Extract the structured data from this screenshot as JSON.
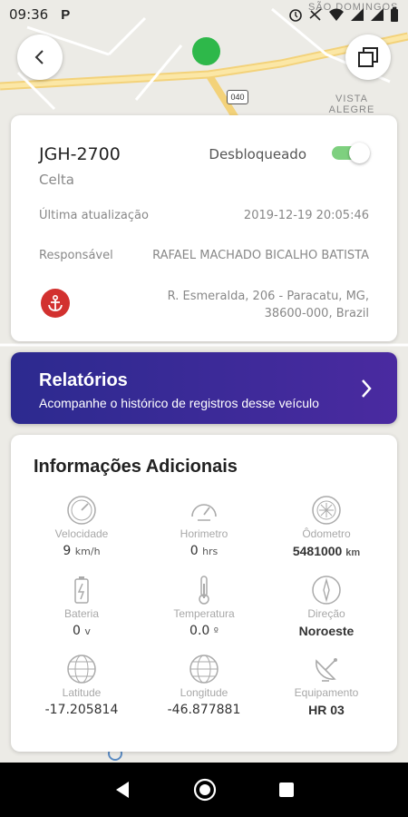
{
  "status_bar": {
    "time": "09:36",
    "app_icon": "P"
  },
  "map": {
    "labels": [
      "SÃO DOMINGOS",
      "VISTA ALEGRE",
      "040"
    ],
    "marker_color": "#2eb84a"
  },
  "vehicle": {
    "plate": "JGH-2700",
    "model": "Celta",
    "lock_status": "Desbloqueado",
    "toggle_on": true,
    "last_update_label": "Última atualização",
    "last_update_value": "2019-12-19 20:05:46",
    "responsible_label": "Responsável",
    "responsible_value": "RAFAEL MACHADO BICALHO BATISTA",
    "address_line1": "R. Esmeralda, 206 - Paracatu, MG,",
    "address_line2": "38600-000, Brazil"
  },
  "reports": {
    "title": "Relatórios",
    "subtitle": "Acompanhe o histórico de registros desse veículo"
  },
  "info": {
    "title": "Informações Adicionais",
    "items": [
      {
        "icon": "speedometer-icon",
        "label": "Velocidade",
        "value": "9",
        "unit": "km/h",
        "bold": false
      },
      {
        "icon": "hourmeter-icon",
        "label": "Horimetro",
        "value": "0",
        "unit": "hrs",
        "bold": false
      },
      {
        "icon": "odometer-icon",
        "label": "Ôdometro",
        "value": "5481000",
        "unit": "km",
        "bold": true
      },
      {
        "icon": "battery-icon",
        "label": "Bateria",
        "value": "0",
        "unit": "v",
        "bold": false
      },
      {
        "icon": "thermometer-icon",
        "label": "Temperatura",
        "value": "0.0",
        "unit": "º",
        "bold": false
      },
      {
        "icon": "compass-icon",
        "label": "Direção",
        "value": "Noroeste",
        "unit": "",
        "bold": true
      },
      {
        "icon": "globe-icon",
        "label": "Latitude",
        "value": "-17.205814",
        "unit": "",
        "bold": false
      },
      {
        "icon": "globe-icon",
        "label": "Longitude",
        "value": "-46.877881",
        "unit": "",
        "bold": false
      },
      {
        "icon": "satellite-dish-icon",
        "label": "Equipamento",
        "value": "HR 03",
        "unit": "",
        "bold": true
      }
    ]
  },
  "colors": {
    "accent_purple": "#3a2a98",
    "toggle_green": "#38b54a",
    "anchor_red": "#d2312f"
  }
}
